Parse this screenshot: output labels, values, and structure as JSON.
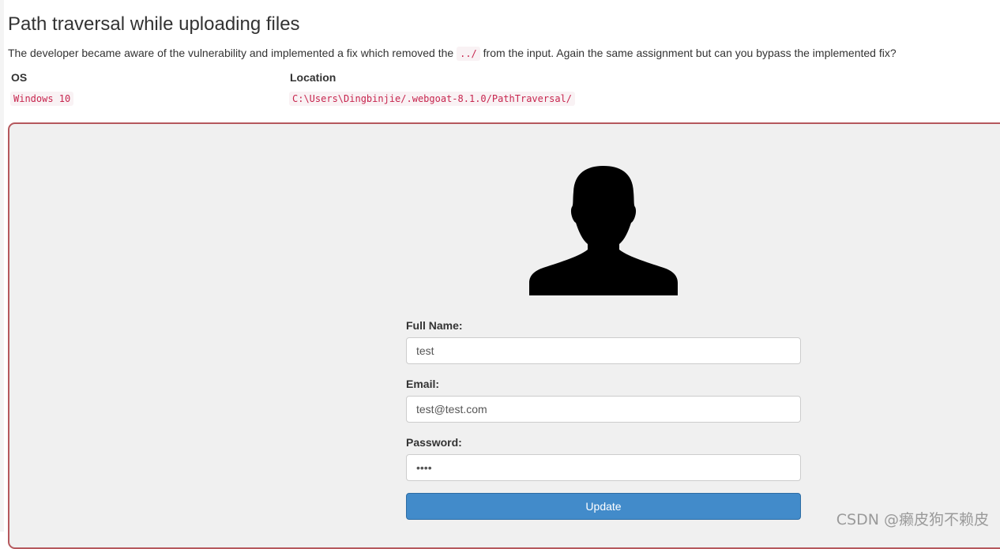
{
  "page": {
    "title": "Path traversal while uploading files",
    "description": {
      "before": "The developer became aware of the vulnerability and implemented a fix which removed the ",
      "code": "../",
      "after": " from the input. Again the same assignment but can you bypass the implemented fix?"
    }
  },
  "env_table": {
    "headers": {
      "os": "OS",
      "location": "Location"
    },
    "row": {
      "os": "Windows 10",
      "location": "C:\\Users\\Dingbinjie/.webgoat-8.1.0/PathTraversal/"
    }
  },
  "form": {
    "icon": "user-silhouette-icon",
    "full_name": {
      "label": "Full Name:",
      "value": "test"
    },
    "email": {
      "label": "Email:",
      "value": "test@test.com"
    },
    "password": {
      "label": "Password:",
      "value": "test"
    },
    "update_button": "Update"
  },
  "colors": {
    "panel_border": "#b5585d",
    "panel_background": "#f0f0f0",
    "button": "#428bca",
    "code_text": "#c7254e",
    "code_background": "#f9f2f4"
  },
  "watermark": "CSDN @癞皮狗不赖皮"
}
